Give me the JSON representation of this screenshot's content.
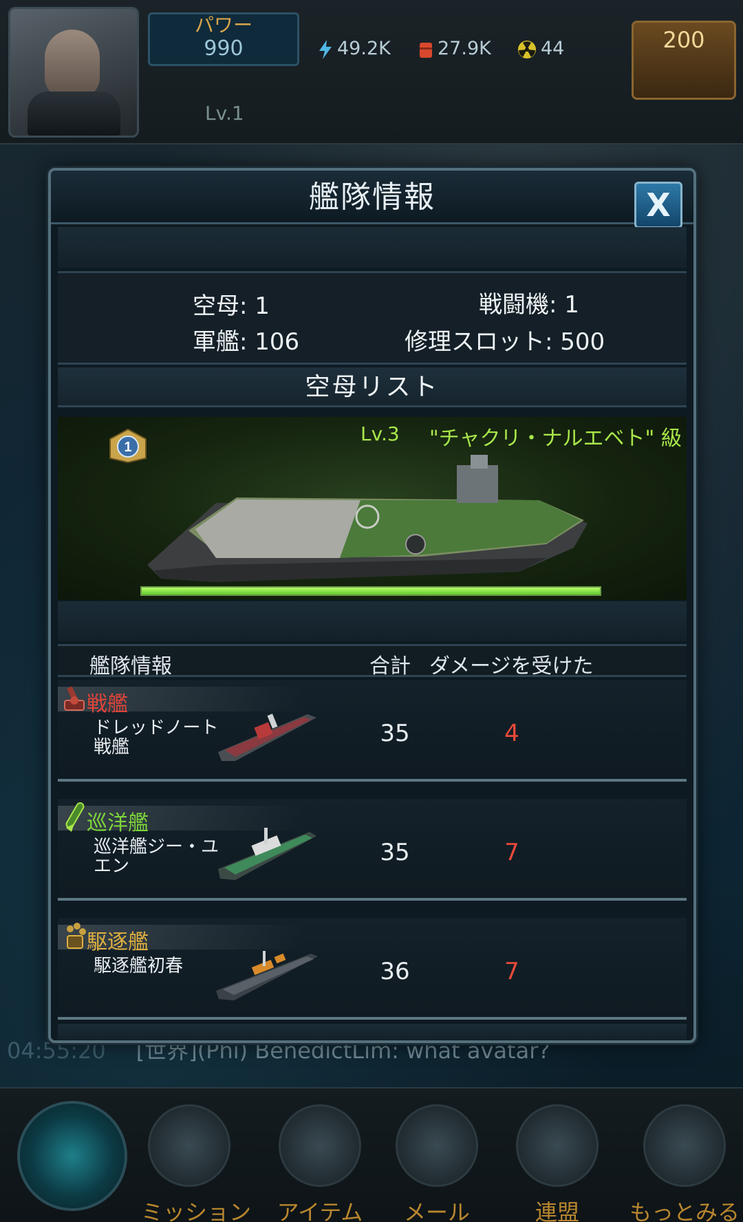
{
  "hud": {
    "power_label": "パワー",
    "power_value": "990",
    "energy": "49.2K",
    "oil": "27.9K",
    "uranium": "44",
    "gold": "200",
    "level": "Lv.1"
  },
  "chat": {
    "time": "04:55:20",
    "message": "[世界](Phi) BenedictLim:  what avatar?"
  },
  "nav": {
    "items": [
      {
        "label": "ミッション",
        "icon": "mission-tablet-icon"
      },
      {
        "label": "アイテム",
        "icon": "item-crate-icon"
      },
      {
        "label": "メール",
        "icon": "mail-envelope-icon"
      },
      {
        "label": "連盟",
        "icon": "alliance-anchor-icon"
      },
      {
        "label": "もっとみる",
        "icon": "more-plus-icon"
      }
    ]
  },
  "modal": {
    "title": "艦隊情報",
    "close_label": "X",
    "stats": {
      "carrier": "空母: 1",
      "fighters": "戦闘機: 1",
      "warships": "軍艦: 106",
      "repair_slots": "修理スロット:  500"
    },
    "carrier_list_title": "空母リスト",
    "carrier": {
      "rank": "1",
      "level": "Lv.3",
      "class_name": "\"チャクリ・ナルエベト\" 級",
      "hp_fraction": 1.0
    },
    "table": {
      "headers": [
        "艦隊情報",
        "合計",
        "ダメージを受けた"
      ],
      "rows": [
        {
          "type": "戦艦",
          "type_color": "#e0443a",
          "icon": "battleship-gun-icon",
          "name": "ドレッドノート戦艦",
          "total": "35",
          "damaged": "4"
        },
        {
          "type": "巡洋艦",
          "type_color": "#7ed63a",
          "icon": "cruiser-missile-icon",
          "name": "巡洋艦ジー・ユエン",
          "total": "35",
          "damaged": "7"
        },
        {
          "type": "駆逐艦",
          "type_color": "#e0b040",
          "icon": "destroyer-launcher-icon",
          "name": "駆逐艦初春",
          "total": "36",
          "damaged": "7"
        }
      ]
    }
  }
}
